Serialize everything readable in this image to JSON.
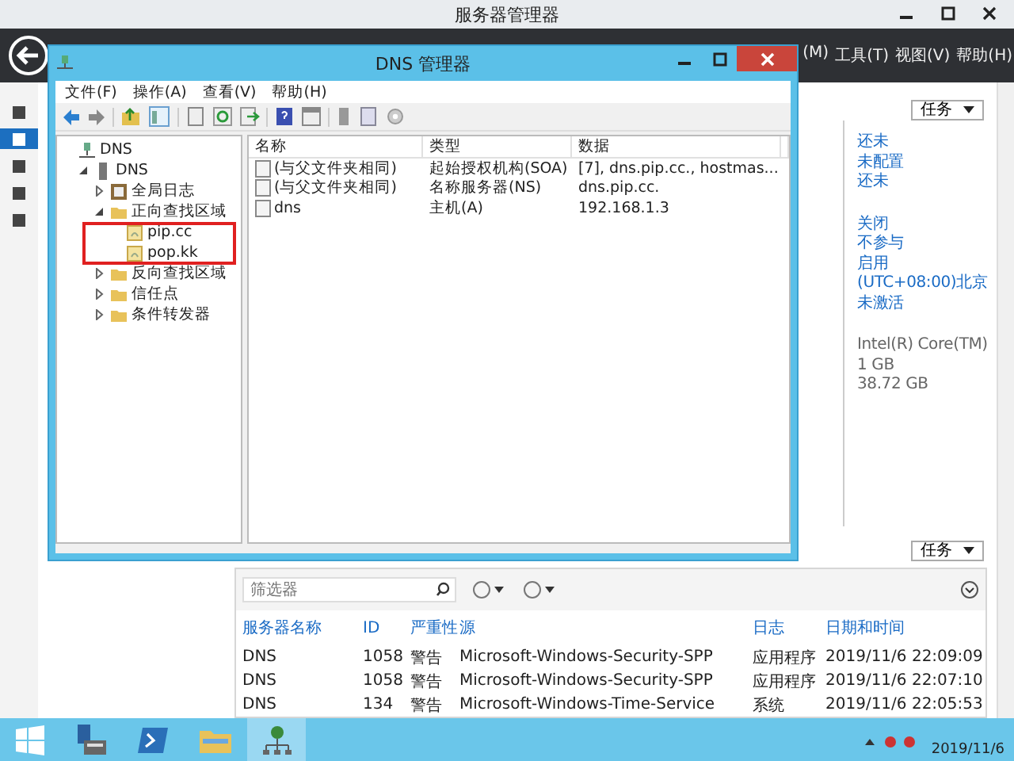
{
  "server_manager": {
    "title": "服务器管理器",
    "menu": [
      "(M)",
      "工具(T)",
      "视图(V)",
      "帮助(H)"
    ],
    "nav": [
      {
        "selected": false
      },
      {
        "selected": true
      },
      {
        "selected": false
      },
      {
        "selected": false
      },
      {
        "selected": false
      }
    ],
    "tasks_button": "任务",
    "properties": [
      {
        "kind": "link",
        "values": [
          "还未",
          "未配置",
          "还未"
        ]
      },
      {
        "kind": "link",
        "values": [
          "关闭",
          "不参与",
          "启用",
          "(UTC+08:00)北京",
          "未激活"
        ]
      },
      {
        "kind": "plain",
        "values": [
          "Intel(R) Core(TM)",
          "1 GB",
          "38.72 GB"
        ]
      }
    ]
  },
  "events": {
    "tasks_button": "任务",
    "filter": {
      "placeholder": "筛选器"
    },
    "columns": [
      "服务器名称",
      "ID",
      "严重性",
      "源",
      "日志",
      "日期和时间"
    ],
    "rows": [
      [
        "DNS",
        "1058",
        "警告",
        "Microsoft-Windows-Security-SPP",
        "应用程序",
        "2019/11/6 22:09:09"
      ],
      [
        "DNS",
        "1058",
        "警告",
        "Microsoft-Windows-Security-SPP",
        "应用程序",
        "2019/11/6 22:07:10"
      ],
      [
        "DNS",
        "134",
        "警告",
        "Microsoft-Windows-Time-Service",
        "系统",
        "2019/11/6 22:05:53"
      ]
    ]
  },
  "dns_window": {
    "title": "DNS 管理器",
    "menu": [
      "文件(F)",
      "操作(A)",
      "查看(V)",
      "帮助(H)"
    ],
    "tree": [
      {
        "label": "DNS",
        "kind": "root",
        "children": [
          {
            "label": "DNS",
            "kind": "server",
            "expanded": true,
            "children": [
              {
                "label": "全局日志",
                "kind": "log",
                "expanded": false
              },
              {
                "label": "正向查找区域",
                "kind": "folder",
                "expanded": true,
                "children": [
                  {
                    "label": "pip.cc",
                    "kind": "zone",
                    "selected": false
                  },
                  {
                    "label": "pop.kk",
                    "kind": "zone",
                    "selected": false
                  }
                ]
              },
              {
                "label": "反向查找区域",
                "kind": "folder",
                "expanded": false
              },
              {
                "label": "信任点",
                "kind": "folder",
                "expanded": false
              },
              {
                "label": "条件转发器",
                "kind": "folder",
                "expanded": false
              }
            ]
          }
        ]
      }
    ],
    "columns": [
      "名称",
      "类型",
      "数据"
    ],
    "rows": [
      [
        "(与父文件夹相同)",
        "起始授权机构(SOA)",
        "[7], dns.pip.cc., hostmas..."
      ],
      [
        "(与父文件夹相同)",
        "名称服务器(NS)",
        "dns.pip.cc."
      ],
      [
        "dns",
        "主机(A)",
        "192.168.1.3"
      ]
    ]
  },
  "taskbar": {
    "apps": [
      {
        "kind": "start",
        "selected": false
      },
      {
        "kind": "server",
        "selected": false
      },
      {
        "kind": "shell",
        "selected": false
      },
      {
        "kind": "folder",
        "selected": false
      },
      {
        "kind": "dns",
        "selected": true
      }
    ],
    "date": "2019/11/6"
  }
}
